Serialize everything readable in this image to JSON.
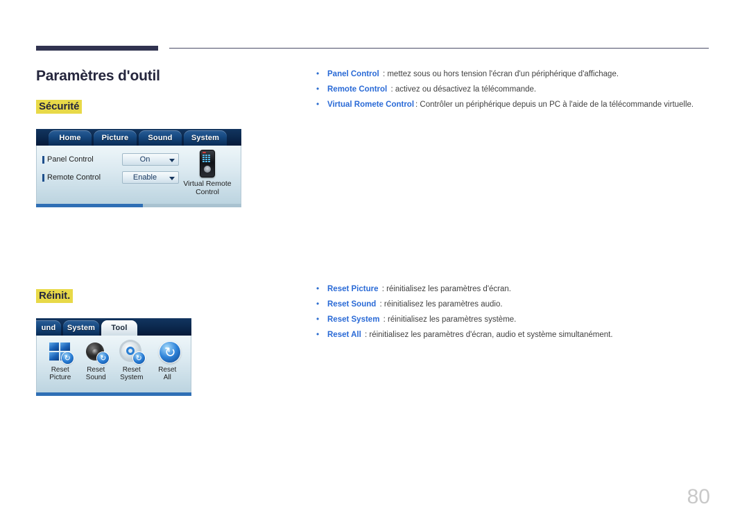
{
  "document": {
    "page_number": "80",
    "title": "Paramètres d'outil"
  },
  "sections": [
    {
      "tag": "Sécurité",
      "bullets": [
        {
          "term": "Panel Control",
          "desc": " : mettez sous ou hors tension l'écran d'un périphérique d'affichage."
        },
        {
          "term": "Remote Control",
          "desc": " : activez ou désactivez la télécommande."
        },
        {
          "term": "Virtual Romete Control",
          "desc": ": Contrôler un périphérique depuis un PC à l'aide de la télécommande virtuelle."
        }
      ]
    },
    {
      "tag": "Réinit.",
      "bullets": [
        {
          "term": "Reset Picture",
          "desc": " : réinitialisez les paramètres d'écran."
        },
        {
          "term": "Reset Sound",
          "desc": " : réinitialisez les paramètres audio."
        },
        {
          "term": "Reset System",
          "desc": " : réinitialisez les paramètres système."
        },
        {
          "term": "Reset All",
          "desc": " : réinitialisez les paramètres d'écran, audio et système simultanément."
        }
      ]
    }
  ],
  "osd_security": {
    "tabs": [
      {
        "label": "Home",
        "active": false
      },
      {
        "label": "Picture",
        "active": false
      },
      {
        "label": "Sound",
        "active": false
      },
      {
        "label": "System",
        "active": false
      }
    ],
    "rows": [
      {
        "label": "Panel Control",
        "value": "On"
      },
      {
        "label": "Remote Control",
        "value": "Enable"
      }
    ],
    "virtual_remote_label": "Virtual Remote Control"
  },
  "osd_tool": {
    "tabs": [
      {
        "label": "und",
        "active": false
      },
      {
        "label": "System",
        "active": false
      },
      {
        "label": "Tool",
        "active": true
      }
    ],
    "items": [
      {
        "line1": "Reset",
        "line2": "Picture"
      },
      {
        "line1": "Reset",
        "line2": "Sound"
      },
      {
        "line1": "Reset",
        "line2": "System"
      },
      {
        "line1": "Reset",
        "line2": "All"
      }
    ]
  },
  "icons": {
    "refresh_badge": "↻",
    "reset_all": "↻",
    "dropdown_caret": "caret-down-icon"
  },
  "colors": {
    "highlight": "#e8d948",
    "link_blue": "#2a6ad6",
    "navy": "#313350",
    "page_number_gray": "#c9c9c9"
  }
}
